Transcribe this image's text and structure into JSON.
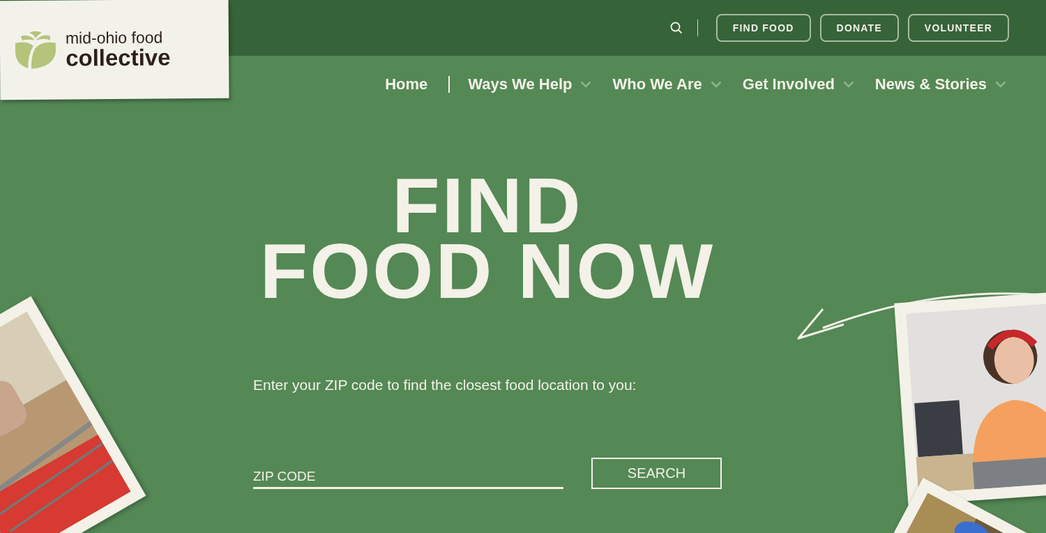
{
  "logo": {
    "line_1": "mid-ohio food",
    "line_2": "collective"
  },
  "top_bar": {
    "buttons": [
      "FIND FOOD",
      "DONATE",
      "VOLUNTEER"
    ]
  },
  "nav": [
    {
      "label": "Home",
      "dropdown": false
    },
    {
      "label": "Ways We Help",
      "dropdown": true
    },
    {
      "label": "Who We Are",
      "dropdown": true
    },
    {
      "label": "Get Involved",
      "dropdown": true
    },
    {
      "label": "News & Stories",
      "dropdown": true
    }
  ],
  "hero": {
    "title_line_1": "FIND",
    "title_line_2": "FOOD NOW",
    "intro": "Enter your ZIP code to find the closest food location to you:",
    "zip_field": {
      "placeholder": "ZIP CODE"
    },
    "search_button": "SEARCH"
  }
}
